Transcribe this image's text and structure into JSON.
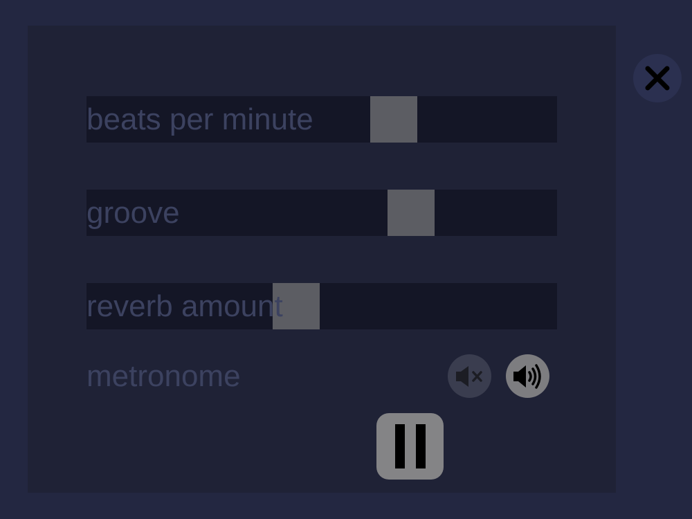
{
  "sliders": [
    {
      "label": "beats per minute",
      "value_fraction": 0.67
    },
    {
      "label": "groove",
      "value_fraction": 0.71
    },
    {
      "label": "reverb amount",
      "value_fraction": 0.44
    }
  ],
  "metronome": {
    "label": "metronome",
    "mute_icon": "speaker-mute-icon",
    "sound_icon": "speaker-sound-icon",
    "state": "on"
  },
  "transport": {
    "pause_icon": "pause-icon"
  },
  "close": {
    "icon": "close-icon"
  },
  "colors": {
    "background": "#232741",
    "panel": "#1f2236",
    "track": "#141626",
    "thumb": "#5c5d63",
    "label": "#3c4260"
  }
}
